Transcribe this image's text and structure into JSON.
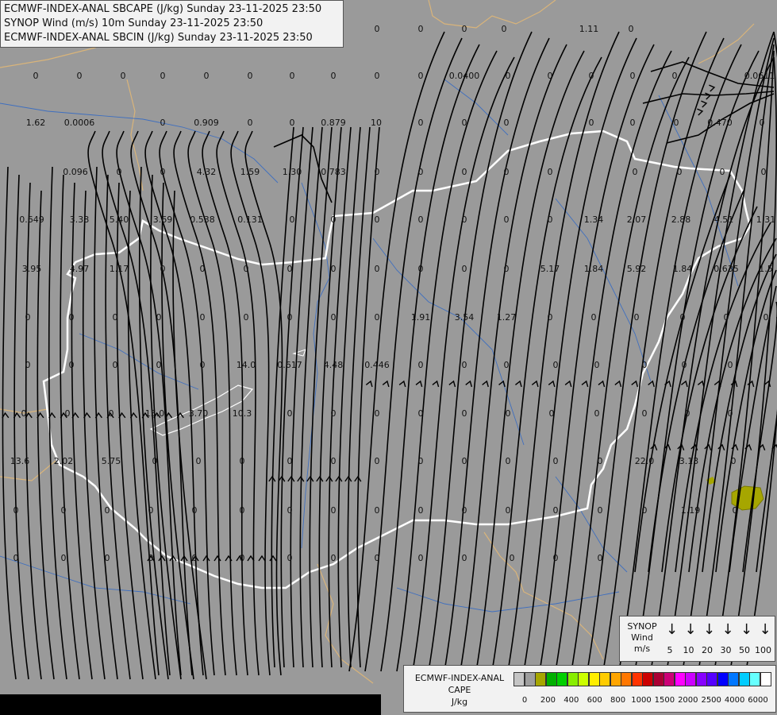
{
  "header": {
    "line1": "ECMWF-INDEX-ANAL SBCAPE (J/kg) Sunday 23-11-2025 23:50",
    "line2": "SYNOP Wind (m/s) 10m Sunday 23-11-2025 23:50",
    "line3": "ECMWF-INDEX-ANAL SBCIN (J/kg) Sunday 23-11-2025 23:50"
  },
  "colors": {
    "background": "#9a9a9a",
    "border_country": "#ffffff",
    "border_region": "#d9b47a",
    "rivers": "#3f6fbf",
    "streamline": "#000000",
    "cape_patch": "#a6a600"
  },
  "synop_legend": {
    "title": "SYNOP",
    "subtitle": "Wind",
    "unit": "m/s",
    "values": [
      "5",
      "10",
      "20",
      "30",
      "50",
      "100"
    ],
    "arrow_icon": "down-arrow-icon"
  },
  "cape_legend": {
    "title": "ECMWF-INDEX-ANAL",
    "subtitle": "CAPE",
    "unit": "J/kg",
    "colors": [
      "#c4c4c4",
      "#9e9e9e",
      "#a6a600",
      "#00b000",
      "#00d000",
      "#88ee00",
      "#ccff00",
      "#ffee00",
      "#ffcc00",
      "#ffa500",
      "#ff7700",
      "#ff3300",
      "#cc0000",
      "#aa0033",
      "#cc0077",
      "#ff00ff",
      "#cc00ff",
      "#8800ff",
      "#5500ff",
      "#0000ff",
      "#0077ff",
      "#00ccff",
      "#66ffff",
      "#ffffff"
    ],
    "ticks": [
      "0",
      "200",
      "400",
      "600",
      "800",
      "1000",
      "1500",
      "2000",
      "2500",
      "4000",
      "6000"
    ]
  },
  "cin_labels": [
    {
      "v": "0"
    },
    {
      "v": "0"
    },
    {
      "v": "0"
    },
    {
      "v": "0"
    },
    {
      "v": "1.11"
    },
    {
      "v": "0"
    },
    {
      "v": "0"
    },
    {
      "v": "0"
    },
    {
      "v": "0"
    },
    {
      "v": "0"
    },
    {
      "v": "0"
    },
    {
      "v": "0"
    },
    {
      "v": "0"
    },
    {
      "v": "0"
    },
    {
      "v": "0"
    },
    {
      "v": "0"
    },
    {
      "v": "0.0400"
    },
    {
      "v": "0"
    },
    {
      "v": "0"
    },
    {
      "v": "0"
    },
    {
      "v": "0"
    },
    {
      "v": "0"
    },
    {
      "v": "0.0611"
    },
    {
      "v": "1.62"
    },
    {
      "v": "0.0006"
    },
    {
      "v": "0"
    },
    {
      "v": "0.909"
    },
    {
      "v": "0"
    },
    {
      "v": "0"
    },
    {
      "v": "0.879"
    },
    {
      "v": "10"
    },
    {
      "v": "0"
    },
    {
      "v": "0"
    },
    {
      "v": "0"
    },
    {
      "v": "0"
    },
    {
      "v": "0"
    },
    {
      "v": "0"
    },
    {
      "v": "0.470"
    },
    {
      "v": "0"
    },
    {
      "v": "0.096"
    },
    {
      "v": "0"
    },
    {
      "v": "0"
    },
    {
      "v": "4.32"
    },
    {
      "v": "1.59"
    },
    {
      "v": "1.30"
    },
    {
      "v": "0.783"
    },
    {
      "v": "0"
    },
    {
      "v": "0"
    },
    {
      "v": "0"
    },
    {
      "v": "0"
    },
    {
      "v": "0"
    },
    {
      "v": "0"
    },
    {
      "v": "0"
    },
    {
      "v": "0"
    },
    {
      "v": "0"
    },
    {
      "v": "0.649"
    },
    {
      "v": "3.38"
    },
    {
      "v": "5.40"
    },
    {
      "v": "3.69"
    },
    {
      "v": "0.538"
    },
    {
      "v": "0.131"
    },
    {
      "v": "0"
    },
    {
      "v": "0"
    },
    {
      "v": "0"
    },
    {
      "v": "0"
    },
    {
      "v": "0"
    },
    {
      "v": "0"
    },
    {
      "v": "0"
    },
    {
      "v": "1.34"
    },
    {
      "v": "2.07"
    },
    {
      "v": "2.88"
    },
    {
      "v": "4.51"
    },
    {
      "v": "1.31"
    },
    {
      "v": "3.95"
    },
    {
      "v": "4.97"
    },
    {
      "v": "1.17"
    },
    {
      "v": "0"
    },
    {
      "v": "0"
    },
    {
      "v": "0"
    },
    {
      "v": "0"
    },
    {
      "v": "0"
    },
    {
      "v": "0"
    },
    {
      "v": "0"
    },
    {
      "v": "0"
    },
    {
      "v": "0"
    },
    {
      "v": "5.17"
    },
    {
      "v": "1.84"
    },
    {
      "v": "5.92"
    },
    {
      "v": "1.84"
    },
    {
      "v": "0.635"
    },
    {
      "v": "1.5"
    },
    {
      "v": "0"
    },
    {
      "v": "0"
    },
    {
      "v": "0"
    },
    {
      "v": "0"
    },
    {
      "v": "0"
    },
    {
      "v": "0"
    },
    {
      "v": "0"
    },
    {
      "v": "0"
    },
    {
      "v": "0"
    },
    {
      "v": "1.91"
    },
    {
      "v": "3.54"
    },
    {
      "v": "1.27"
    },
    {
      "v": "0"
    },
    {
      "v": "0"
    },
    {
      "v": "0"
    },
    {
      "v": "0"
    },
    {
      "v": "0"
    },
    {
      "v": "0"
    },
    {
      "v": "0"
    },
    {
      "v": "0"
    },
    {
      "v": "0"
    },
    {
      "v": "0"
    },
    {
      "v": "0"
    },
    {
      "v": "14.0"
    },
    {
      "v": "0.617"
    },
    {
      "v": "4.48"
    },
    {
      "v": "0.446"
    },
    {
      "v": "0"
    },
    {
      "v": "0"
    },
    {
      "v": "0"
    },
    {
      "v": "0"
    },
    {
      "v": "0"
    },
    {
      "v": "0"
    },
    {
      "v": "0"
    },
    {
      "v": "0"
    },
    {
      "v": "0"
    },
    {
      "v": "0"
    },
    {
      "v": "0"
    },
    {
      "v": "15.0"
    },
    {
      "v": "3.70"
    },
    {
      "v": "10.3"
    },
    {
      "v": "0"
    },
    {
      "v": "0"
    },
    {
      "v": "0"
    },
    {
      "v": "0"
    },
    {
      "v": "0"
    },
    {
      "v": "0"
    },
    {
      "v": "0"
    },
    {
      "v": "0"
    },
    {
      "v": "0"
    },
    {
      "v": "0"
    },
    {
      "v": "0"
    },
    {
      "v": "13.6"
    },
    {
      "v": "2.02"
    },
    {
      "v": "5.75"
    },
    {
      "v": "0"
    },
    {
      "v": "0"
    },
    {
      "v": "0"
    },
    {
      "v": "0"
    },
    {
      "v": "0"
    },
    {
      "v": "0"
    },
    {
      "v": "0"
    },
    {
      "v": "0"
    },
    {
      "v": "0"
    },
    {
      "v": "0"
    },
    {
      "v": "0"
    },
    {
      "v": "22.0"
    },
    {
      "v": "3.13"
    },
    {
      "v": "0"
    },
    {
      "v": "0"
    },
    {
      "v": "0"
    },
    {
      "v": "0"
    },
    {
      "v": "0"
    },
    {
      "v": "0"
    },
    {
      "v": "0"
    },
    {
      "v": "0"
    },
    {
      "v": "0"
    },
    {
      "v": "0"
    },
    {
      "v": "0"
    },
    {
      "v": "0"
    },
    {
      "v": "0"
    },
    {
      "v": "0"
    },
    {
      "v": "0"
    },
    {
      "v": "0"
    },
    {
      "v": "1.19"
    },
    {
      "v": "0"
    },
    {
      "v": "0"
    },
    {
      "v": "0"
    },
    {
      "v": "0"
    },
    {
      "v": "0"
    },
    {
      "v": "0"
    },
    {
      "v": "0"
    },
    {
      "v": "0"
    },
    {
      "v": "0"
    },
    {
      "v": "0"
    },
    {
      "v": "0"
    },
    {
      "v": "0"
    },
    {
      "v": "0"
    },
    {
      "v": "0"
    },
    {
      "v": "0"
    }
  ]
}
